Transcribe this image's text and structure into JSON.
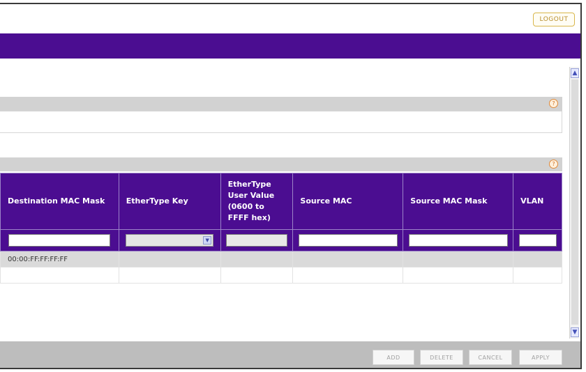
{
  "header": {
    "logout_label": "LOGOUT"
  },
  "sections": [
    {
      "help_icon": "help-icon"
    },
    {
      "help_icon": "help-icon"
    }
  ],
  "table": {
    "columns": [
      "Destination MAC Mask",
      "EtherType Key",
      "EtherType User Value (0600 to FFFF hex)",
      "Source MAC",
      "Source MAC Mask",
      "VLAN"
    ],
    "filter": {
      "dest_mac_mask": "",
      "ethertype_key": "",
      "ethertype_user_value": "",
      "source_mac": "",
      "source_mac_mask": "",
      "vlan": ""
    },
    "rows": [
      {
        "dest_mac_mask": "00:00:FF:FF:FF:FF",
        "ethertype_key": "",
        "ethertype_user_value": "",
        "source_mac": "",
        "source_mac_mask": "",
        "vlan": ""
      }
    ]
  },
  "footer": {
    "add_label": "ADD",
    "delete_label": "DELETE",
    "cancel_label": "CANCEL",
    "apply_label": "APPLY"
  },
  "colors": {
    "brand_purple": "#4b0d91",
    "section_gray": "#d2d2d2",
    "footer_gray": "#bdbdbd",
    "logout_gold": "#d8b64a"
  }
}
